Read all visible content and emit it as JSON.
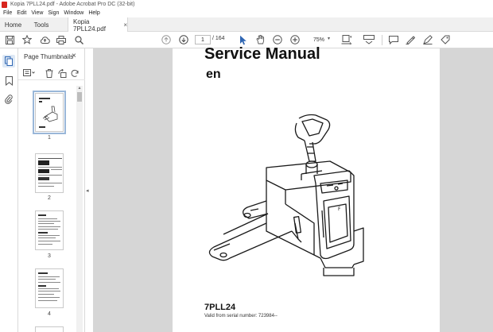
{
  "window": {
    "title": "Kopia 7PLL24.pdf - Adobe Acrobat Pro DC (32-bit)"
  },
  "menu": [
    "File",
    "Edit",
    "View",
    "Sign",
    "Window",
    "Help"
  ],
  "tabs": {
    "home": "Home",
    "tools": "Tools",
    "document": "Kopia 7PLL24.pdf",
    "close_glyph": "×"
  },
  "toolbar": {
    "current_page": "1",
    "page_total": "/ 164",
    "zoom": "75%"
  },
  "thumbnails": {
    "title": "Page Thumbnails",
    "close_glyph": "×",
    "pages": [
      "1",
      "2",
      "3",
      "4"
    ],
    "selected_page": 1
  },
  "document": {
    "title": "Service Manual",
    "language": "en",
    "model": "7PLL24",
    "serial": "Valid from serial number: 723984--"
  },
  "colors": {
    "accent": "#d7261e",
    "selection": "#9ab7d9",
    "canvas": "#d6d6d6"
  },
  "icons": {
    "sidebar": [
      "page-thumbnails-icon",
      "bookmark-icon",
      "attachment-icon"
    ],
    "toolbar": [
      "save-icon",
      "star-icon",
      "upload-icon",
      "print-icon",
      "search-icon",
      "prev-page-icon",
      "next-page-icon",
      "select-cursor-icon",
      "hand-icon",
      "zoom-out-icon",
      "zoom-in-icon",
      "fit-page-icon",
      "scroll-mode-icon",
      "comment-icon",
      "highlight-icon",
      "sign-icon",
      "fill-sign-icon"
    ]
  }
}
